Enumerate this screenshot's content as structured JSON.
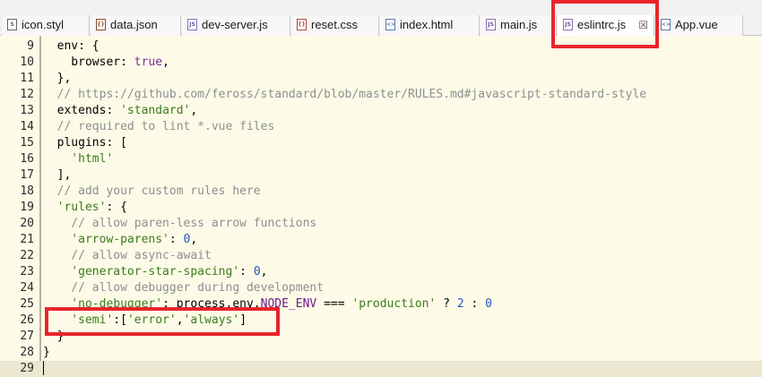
{
  "tabs": [
    {
      "label": "icon.styl",
      "icon": "stylus-file-icon",
      "kind": "styl",
      "glyph": "S"
    },
    {
      "label": "data.json",
      "icon": "json-file-icon",
      "kind": "json",
      "glyph": "{}"
    },
    {
      "label": "dev-server.js",
      "icon": "js-file-icon",
      "kind": "js",
      "glyph": "JS"
    },
    {
      "label": "reset.css",
      "icon": "css-file-icon",
      "kind": "css",
      "glyph": "{}"
    },
    {
      "label": "index.html",
      "icon": "html-file-icon",
      "kind": "html",
      "glyph": "<>"
    },
    {
      "label": "main.js",
      "icon": "js-file-icon",
      "kind": "js",
      "glyph": "JS"
    },
    {
      "label": "eslintrc.js",
      "icon": "js-file-icon",
      "kind": "js",
      "glyph": "JS",
      "active": true,
      "close": "☒"
    },
    {
      "label": "App.vue",
      "icon": "vue-file-icon",
      "kind": "vue",
      "glyph": "<>"
    }
  ],
  "lines": [
    {
      "n": "9",
      "tokens": [
        [
          "key",
          "  env"
        ],
        [
          "pun",
          ": {"
        ]
      ]
    },
    {
      "n": "10",
      "tokens": [
        [
          "key",
          "    browser"
        ],
        [
          "pun",
          ": "
        ],
        [
          "bool",
          "true"
        ],
        [
          "pun",
          ","
        ]
      ]
    },
    {
      "n": "11",
      "tokens": [
        [
          "pun",
          "  },"
        ]
      ]
    },
    {
      "n": "12",
      "tokens": [
        [
          "com",
          "  // https://github.com/feross/standard/blob/master/RULES.md#javascript-standard-style"
        ]
      ]
    },
    {
      "n": "13",
      "tokens": [
        [
          "key",
          "  extends"
        ],
        [
          "pun",
          ": "
        ],
        [
          "str",
          "'standard'"
        ],
        [
          "pun",
          ","
        ]
      ]
    },
    {
      "n": "14",
      "tokens": [
        [
          "com",
          "  // required to lint *.vue files"
        ]
      ]
    },
    {
      "n": "15",
      "tokens": [
        [
          "key",
          "  plugins"
        ],
        [
          "pun",
          ": ["
        ]
      ]
    },
    {
      "n": "16",
      "tokens": [
        [
          "str",
          "    'html'"
        ]
      ]
    },
    {
      "n": "17",
      "tokens": [
        [
          "pun",
          "  ],"
        ]
      ]
    },
    {
      "n": "18",
      "tokens": [
        [
          "com",
          "  // add your custom rules here"
        ]
      ]
    },
    {
      "n": "19",
      "tokens": [
        [
          "str",
          "  'rules'"
        ],
        [
          "pun",
          ": {"
        ]
      ]
    },
    {
      "n": "20",
      "tokens": [
        [
          "com",
          "    // allow paren-less arrow functions"
        ]
      ]
    },
    {
      "n": "21",
      "tokens": [
        [
          "str",
          "    'arrow-parens'"
        ],
        [
          "pun",
          ": "
        ],
        [
          "num",
          "0"
        ],
        [
          "pun",
          ","
        ]
      ]
    },
    {
      "n": "22",
      "tokens": [
        [
          "com",
          "    // allow async-await"
        ]
      ]
    },
    {
      "n": "23",
      "tokens": [
        [
          "str",
          "    'generator-star-spacing'"
        ],
        [
          "pun",
          ": "
        ],
        [
          "num",
          "0"
        ],
        [
          "pun",
          ","
        ]
      ]
    },
    {
      "n": "24",
      "tokens": [
        [
          "com",
          "    // allow debugger during development"
        ]
      ]
    },
    {
      "n": "25",
      "tokens": [
        [
          "str",
          "    'no-debugger'"
        ],
        [
          "pun",
          ": process.env."
        ],
        [
          "const",
          "NODE_ENV"
        ],
        [
          "pun",
          " === "
        ],
        [
          "str",
          "'production'"
        ],
        [
          "pun",
          " ? "
        ],
        [
          "num",
          "2"
        ],
        [
          "pun",
          " : "
        ],
        [
          "num",
          "0"
        ]
      ]
    },
    {
      "n": "26",
      "tokens": [
        [
          "str",
          "    'semi'"
        ],
        [
          "pun",
          ":["
        ],
        [
          "str",
          "'error'"
        ],
        [
          "pun",
          ","
        ],
        [
          "str",
          "'always'"
        ],
        [
          "pun",
          "]"
        ]
      ]
    },
    {
      "n": "27",
      "tokens": [
        [
          "pun",
          "  }"
        ]
      ]
    },
    {
      "n": "28",
      "tokens": [
        [
          "pun",
          "}"
        ]
      ]
    },
    {
      "n": "29",
      "tokens": [],
      "current": true
    }
  ],
  "colors": {
    "highlight": "#e8252b",
    "editor_bg": "#fdfbe7",
    "current_line": "#ece7d0"
  }
}
